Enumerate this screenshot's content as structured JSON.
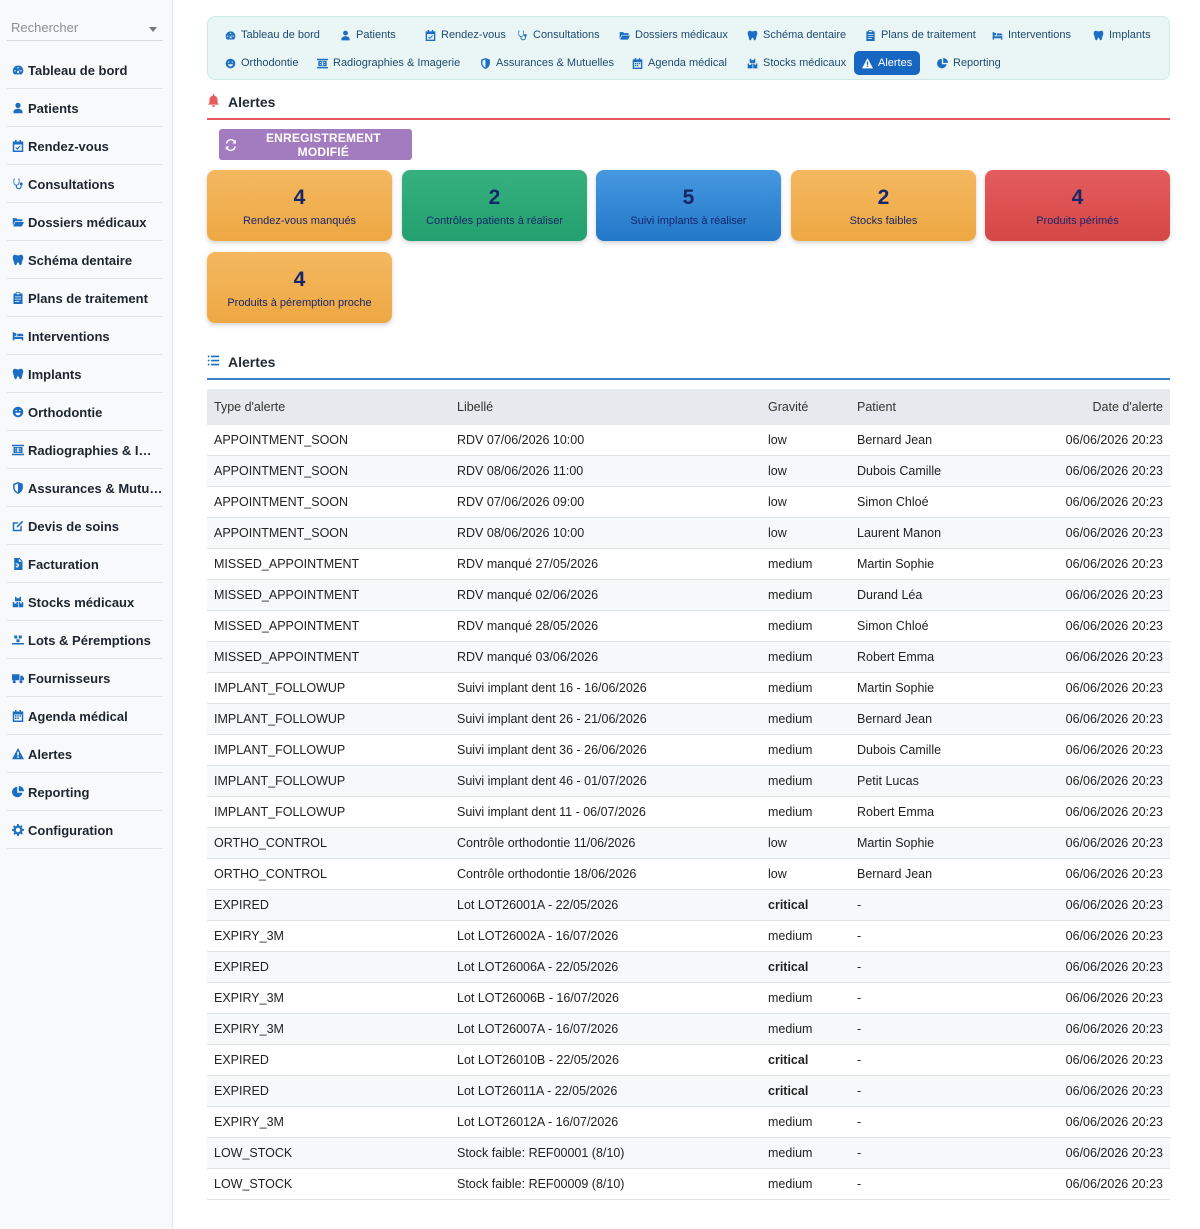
{
  "search": {
    "placeholder": "Rechercher"
  },
  "sidebar": {
    "items": [
      {
        "label": "Tableau de bord",
        "icon": "gauge-icon"
      },
      {
        "label": "Patients",
        "icon": "user-icon"
      },
      {
        "label": "Rendez-vous",
        "icon": "calendar-check-icon"
      },
      {
        "label": "Consultations",
        "icon": "stethoscope-icon"
      },
      {
        "label": "Dossiers médicaux",
        "icon": "folder-open-icon"
      },
      {
        "label": "Schéma dentaire",
        "icon": "tooth-icon"
      },
      {
        "label": "Plans de traitement",
        "icon": "clipboard-icon"
      },
      {
        "label": "Interventions",
        "icon": "bed-icon"
      },
      {
        "label": "Implants",
        "icon": "tooth-icon"
      },
      {
        "label": "Orthodontie",
        "icon": "smile-icon"
      },
      {
        "label": "Radiographies & Ima…",
        "icon": "xray-icon"
      },
      {
        "label": "Assurances & Mutue…",
        "icon": "shield-icon"
      },
      {
        "label": "Devis de soins",
        "icon": "edit-icon"
      },
      {
        "label": "Facturation",
        "icon": "invoice-icon"
      },
      {
        "label": "Stocks médicaux",
        "icon": "boxes-icon"
      },
      {
        "label": "Lots & Péremptions",
        "icon": "pallet-icon"
      },
      {
        "label": "Fournisseurs",
        "icon": "truck-icon"
      },
      {
        "label": "Agenda médical",
        "icon": "calendar-icon"
      },
      {
        "label": "Alertes",
        "icon": "warning-icon"
      },
      {
        "label": "Reporting",
        "icon": "pie-chart-icon"
      },
      {
        "label": "Configuration",
        "icon": "gear-icon"
      }
    ]
  },
  "topnav": {
    "row1": [
      {
        "label": "Tableau de bord",
        "icon": "gauge-icon"
      },
      {
        "label": "Patients",
        "icon": "user-icon"
      },
      {
        "label": "Rendez-vous",
        "icon": "calendar-check-icon"
      },
      {
        "label": "Consultations",
        "icon": "stethoscope-icon"
      },
      {
        "label": "Dossiers médicaux",
        "icon": "folder-open-icon"
      },
      {
        "label": "Schéma dentaire",
        "icon": "tooth-icon"
      },
      {
        "label": "Plans de traitement",
        "icon": "clipboard-icon"
      },
      {
        "label": "Interventions",
        "icon": "bed-icon"
      },
      {
        "label": "Implants",
        "icon": "tooth-icon"
      }
    ],
    "row2": [
      {
        "label": "Orthodontie",
        "icon": "smile-icon"
      },
      {
        "label": "Radiographies & Imagerie",
        "icon": "xray-icon"
      },
      {
        "label": "Assurances & Mutuelles",
        "icon": "shield-icon"
      },
      {
        "label": "Agenda médical",
        "icon": "calendar-icon"
      },
      {
        "label": "Stocks médicaux",
        "icon": "boxes-icon"
      },
      {
        "label": "Alertes",
        "icon": "warning-icon",
        "active": true
      },
      {
        "label": "Reporting",
        "icon": "pie-chart-icon"
      }
    ]
  },
  "alerts_section": {
    "title": "Alertes",
    "status_button": "ENREGISTREMENT MODIFIÉ",
    "cards": [
      {
        "value": "4",
        "label": "Rendez-vous manqués",
        "color": "#f0ab4a"
      },
      {
        "value": "2",
        "label": "Contrôles patients à réaliser",
        "color": "#27a774"
      },
      {
        "value": "5",
        "label": "Suivi implants à réaliser",
        "color": "#2f85d2"
      },
      {
        "value": "2",
        "label": "Stocks faibles",
        "color": "#f0ab4a"
      },
      {
        "value": "4",
        "label": "Produits périmés",
        "color": "#dc5050"
      },
      {
        "value": "4",
        "label": "Produits à péremption proche",
        "color": "#f0ab4a"
      }
    ]
  },
  "table_section": {
    "title": "Alertes",
    "columns": [
      "Type d'alerte",
      "Libellé",
      "Gravité",
      "Patient",
      "Date d'alerte"
    ],
    "rows": [
      [
        "APPOINTMENT_SOON",
        "RDV 07/06/2026 10:00",
        "low",
        "Bernard Jean",
        "06/06/2026 20:23"
      ],
      [
        "APPOINTMENT_SOON",
        "RDV 08/06/2026 11:00",
        "low",
        "Dubois Camille",
        "06/06/2026 20:23"
      ],
      [
        "APPOINTMENT_SOON",
        "RDV 07/06/2026 09:00",
        "low",
        "Simon Chloé",
        "06/06/2026 20:23"
      ],
      [
        "APPOINTMENT_SOON",
        "RDV 08/06/2026 10:00",
        "low",
        "Laurent Manon",
        "06/06/2026 20:23"
      ],
      [
        "MISSED_APPOINTMENT",
        "RDV manqué 27/05/2026",
        "medium",
        "Martin Sophie",
        "06/06/2026 20:23"
      ],
      [
        "MISSED_APPOINTMENT",
        "RDV manqué 02/06/2026",
        "medium",
        "Durand Léa",
        "06/06/2026 20:23"
      ],
      [
        "MISSED_APPOINTMENT",
        "RDV manqué 28/05/2026",
        "medium",
        "Simon Chloé",
        "06/06/2026 20:23"
      ],
      [
        "MISSED_APPOINTMENT",
        "RDV manqué 03/06/2026",
        "medium",
        "Robert Emma",
        "06/06/2026 20:23"
      ],
      [
        "IMPLANT_FOLLOWUP",
        "Suivi implant dent 16 - 16/06/2026",
        "medium",
        "Martin Sophie",
        "06/06/2026 20:23"
      ],
      [
        "IMPLANT_FOLLOWUP",
        "Suivi implant dent 26 - 21/06/2026",
        "medium",
        "Bernard Jean",
        "06/06/2026 20:23"
      ],
      [
        "IMPLANT_FOLLOWUP",
        "Suivi implant dent 36 - 26/06/2026",
        "medium",
        "Dubois Camille",
        "06/06/2026 20:23"
      ],
      [
        "IMPLANT_FOLLOWUP",
        "Suivi implant dent 46 - 01/07/2026",
        "medium",
        "Petit Lucas",
        "06/06/2026 20:23"
      ],
      [
        "IMPLANT_FOLLOWUP",
        "Suivi implant dent 11 - 06/07/2026",
        "medium",
        "Robert Emma",
        "06/06/2026 20:23"
      ],
      [
        "ORTHO_CONTROL",
        "Contrôle orthodontie 11/06/2026",
        "low",
        "Martin Sophie",
        "06/06/2026 20:23"
      ],
      [
        "ORTHO_CONTROL",
        "Contrôle orthodontie 18/06/2026",
        "low",
        "Bernard Jean",
        "06/06/2026 20:23"
      ],
      [
        "EXPIRED",
        "Lot LOT26001A - 22/05/2026",
        "critical",
        "-",
        "06/06/2026 20:23"
      ],
      [
        "EXPIRY_3M",
        "Lot LOT26002A - 16/07/2026",
        "medium",
        "-",
        "06/06/2026 20:23"
      ],
      [
        "EXPIRED",
        "Lot LOT26006A - 22/05/2026",
        "critical",
        "-",
        "06/06/2026 20:23"
      ],
      [
        "EXPIRY_3M",
        "Lot LOT26006B - 16/07/2026",
        "medium",
        "-",
        "06/06/2026 20:23"
      ],
      [
        "EXPIRY_3M",
        "Lot LOT26007A - 16/07/2026",
        "medium",
        "-",
        "06/06/2026 20:23"
      ],
      [
        "EXPIRED",
        "Lot LOT26010B - 22/05/2026",
        "critical",
        "-",
        "06/06/2026 20:23"
      ],
      [
        "EXPIRED",
        "Lot LOT26011A - 22/05/2026",
        "critical",
        "-",
        "06/06/2026 20:23"
      ],
      [
        "EXPIRY_3M",
        "Lot LOT26012A - 16/07/2026",
        "medium",
        "-",
        "06/06/2026 20:23"
      ],
      [
        "LOW_STOCK",
        "Stock faible: REF00001 (8/10)",
        "medium",
        "-",
        "06/06/2026 20:23"
      ],
      [
        "LOW_STOCK",
        "Stock faible: REF00009 (8/10)",
        "medium",
        "-",
        "06/06/2026 20:23"
      ]
    ]
  },
  "colors": {
    "accent": "#1766c2",
    "danger": "#e55a5a",
    "severity_low": "#3a78b8",
    "severity_medium": "#e39a1c",
    "severity_critical": "#d43b3b"
  }
}
